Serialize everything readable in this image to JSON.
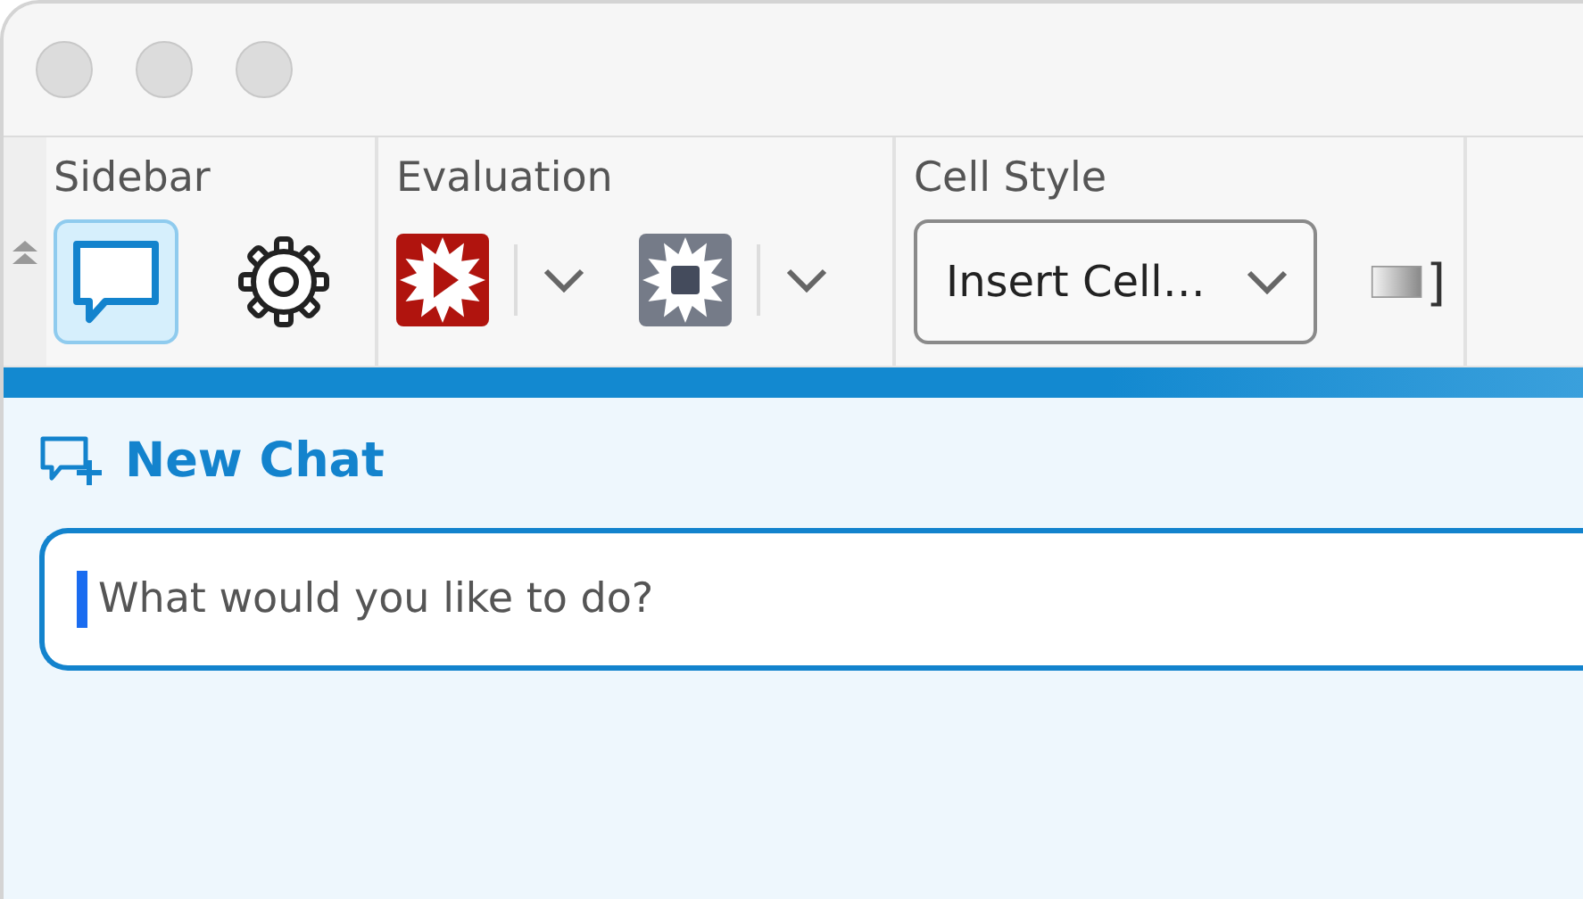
{
  "toolbar": {
    "groups": [
      {
        "kind": "sidebar",
        "label": "Sidebar",
        "buttons": [
          {
            "kind": "chat",
            "selected": true
          },
          {
            "kind": "settings",
            "selected": false
          }
        ]
      },
      {
        "kind": "evaluation",
        "label": "Evaluation",
        "buttons": [
          {
            "kind": "run"
          },
          {
            "kind": "stop"
          }
        ]
      },
      {
        "kind": "cellstyle",
        "label": "Cell Style",
        "dropdown": {
          "value": "Insert Cell…"
        },
        "extra": "]"
      }
    ]
  },
  "chat": {
    "new_chat": "New Chat",
    "input": {
      "placeholder": "What would you like to do?"
    }
  }
}
